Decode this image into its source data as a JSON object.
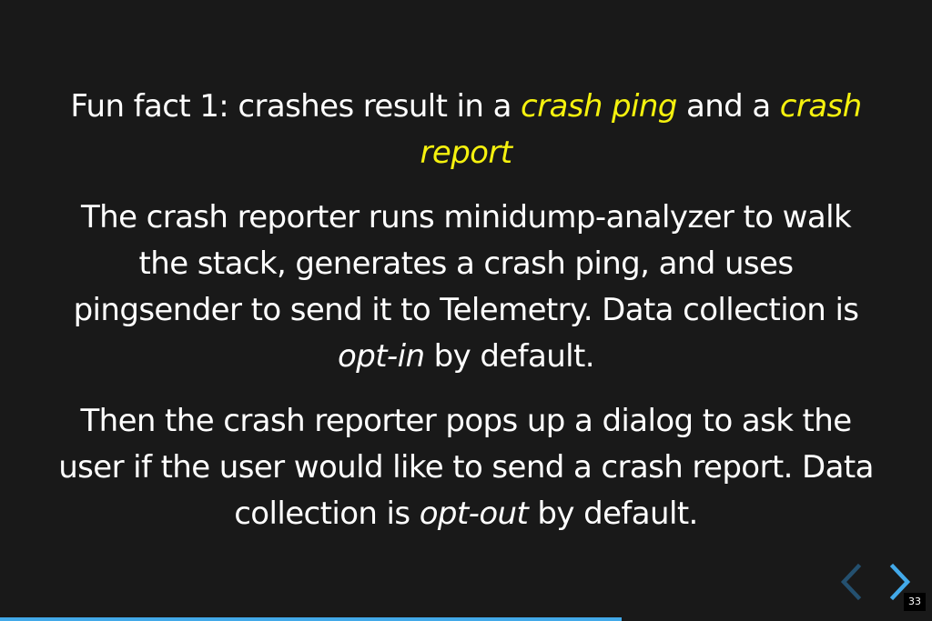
{
  "slide": {
    "heading": {
      "pre": "Fun fact 1: crashes result in a ",
      "hl1": "crash ping",
      "mid": " and a ",
      "hl2": "crash report"
    },
    "para1": {
      "pre": "The crash reporter runs minidump-analyzer to walk the stack, generates a crash ping, and uses pingsender to send it to Telemetry. Data collection is ",
      "em": "opt-in",
      "post": " by default."
    },
    "para2": {
      "pre": "Then the crash reporter pops up a dialog to ask the user if the user would like to send a crash report. Data collection is ",
      "em": "opt-out",
      "post": " by default."
    }
  },
  "navigation": {
    "prev_icon": "chevron-left-icon",
    "next_icon": "chevron-right-icon",
    "prev_enabled": false,
    "next_enabled": true
  },
  "slide_number": "33",
  "progress": {
    "fraction": 0.667
  },
  "colors": {
    "background": "#191919",
    "text": "#ffffff",
    "highlight": "#f5f10e",
    "accent": "#42a9e9",
    "arrow_disabled": "#24506f"
  }
}
